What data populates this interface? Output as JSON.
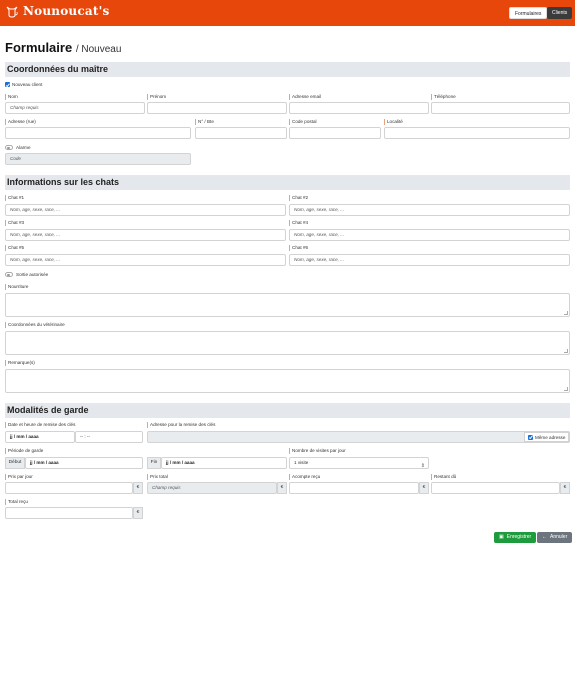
{
  "header": {
    "brand": "Nounoucat's",
    "nav": {
      "formulaires": "Formulaires",
      "clients": "Clients"
    }
  },
  "page": {
    "title": "Formulaire",
    "subtitle": "/ Nouveau"
  },
  "maitre": {
    "heading": "Coordonnées du maître",
    "nouveau_client": "Nouveau client",
    "nom": {
      "label": "Nom",
      "placeholder": "Champ requis"
    },
    "prenom": {
      "label": "Prénom",
      "placeholder": ""
    },
    "email": {
      "label": "Adresse email",
      "placeholder": ""
    },
    "telephone": {
      "label": "Téléphone",
      "placeholder": ""
    },
    "adresse": {
      "label": "Adresse (rue)",
      "placeholder": ""
    },
    "numero": {
      "label": "N° / Bte",
      "placeholder": ""
    },
    "code_postal": {
      "label": "Code postal",
      "placeholder": ""
    },
    "localite": {
      "label": "Localité",
      "placeholder": ""
    },
    "alarme": "Alarme",
    "code": {
      "placeholder": "Code"
    }
  },
  "chats": {
    "heading": "Informations sur les chats",
    "items": [
      {
        "label": "Chat #1",
        "placeholder": "Nom, age, sexe, race, ..."
      },
      {
        "label": "Chat #2",
        "placeholder": "Nom, age, sexe, race, ..."
      },
      {
        "label": "Chat #3",
        "placeholder": "Nom, age, sexe, race, ..."
      },
      {
        "label": "Chat #4",
        "placeholder": "Nom, age, sexe, race, ..."
      },
      {
        "label": "Chat #5",
        "placeholder": "Nom, age, sexe, race, ..."
      },
      {
        "label": "Chat #6",
        "placeholder": "Nom, age, sexe, race, ..."
      }
    ],
    "sortie": "Sortie autorisée",
    "nourriture": "Nourriture",
    "veterinaire": "Coordonnées du vétérinaire",
    "remarques": "Remarque(s)"
  },
  "garde": {
    "heading": "Modalités de garde",
    "remise_date": {
      "label": "Date et heure de remise des clés",
      "date": "jj / mm / aaaa",
      "time": "-- : --"
    },
    "remise_adresse": {
      "label": "Adresse pour la remise des clés",
      "meme": "Même adresse"
    },
    "periode": {
      "label": "Période de garde",
      "debut": "Début",
      "fin": "Fin",
      "date1": "jj / mm / aaaa",
      "date2": "jj / mm / aaaa"
    },
    "visites": {
      "label": "Nombre de visites par jour",
      "value": "1 visite"
    },
    "prix_jour": {
      "label": "Prix par jour",
      "currency": "€"
    },
    "prix_total": {
      "label": "Prix total",
      "placeholder": "Champ requis",
      "currency": "€"
    },
    "acompte": {
      "label": "Acompte reçu",
      "currency": "€"
    },
    "restant": {
      "label": "Restant dû",
      "currency": "€"
    },
    "total_recu": {
      "label": "Total reçu",
      "currency": "€"
    }
  },
  "actions": {
    "save": "Enregistrer",
    "cancel": "Annuler"
  }
}
